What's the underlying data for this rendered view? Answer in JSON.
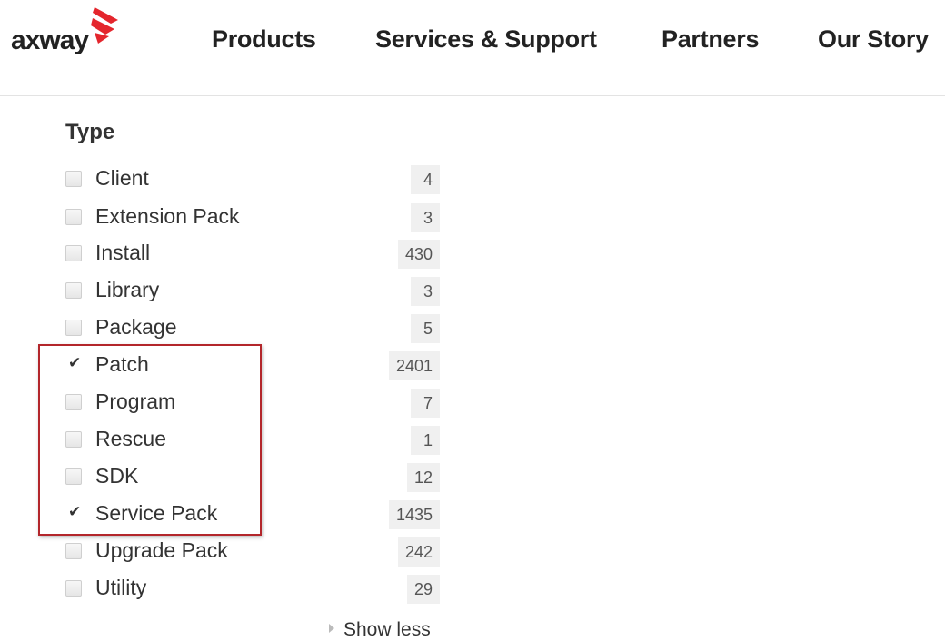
{
  "brand": {
    "logo_text": "axway",
    "accent_color": "#e4262d"
  },
  "nav": {
    "items": [
      {
        "label": "Products"
      },
      {
        "label": "Services & Support"
      },
      {
        "label": "Partners"
      },
      {
        "label": "Our Story"
      }
    ]
  },
  "facet": {
    "title": "Type",
    "options": [
      {
        "label": "Client",
        "count": "4",
        "checked": false
      },
      {
        "label": "Extension Pack",
        "count": "3",
        "checked": false
      },
      {
        "label": "Install",
        "count": "430",
        "checked": false
      },
      {
        "label": "Library",
        "count": "3",
        "checked": false
      },
      {
        "label": "Package",
        "count": "5",
        "checked": false
      },
      {
        "label": "Patch",
        "count": "2401",
        "checked": true
      },
      {
        "label": "Program",
        "count": "7",
        "checked": false
      },
      {
        "label": "Rescue",
        "count": "1",
        "checked": false
      },
      {
        "label": "SDK",
        "count": "12",
        "checked": false
      },
      {
        "label": "Service Pack",
        "count": "1435",
        "checked": true
      },
      {
        "label": "Upgrade Pack",
        "count": "242",
        "checked": false
      },
      {
        "label": "Utility",
        "count": "29",
        "checked": false
      }
    ],
    "show_less_label": "Show less",
    "highlight_color": "#b3262b"
  }
}
